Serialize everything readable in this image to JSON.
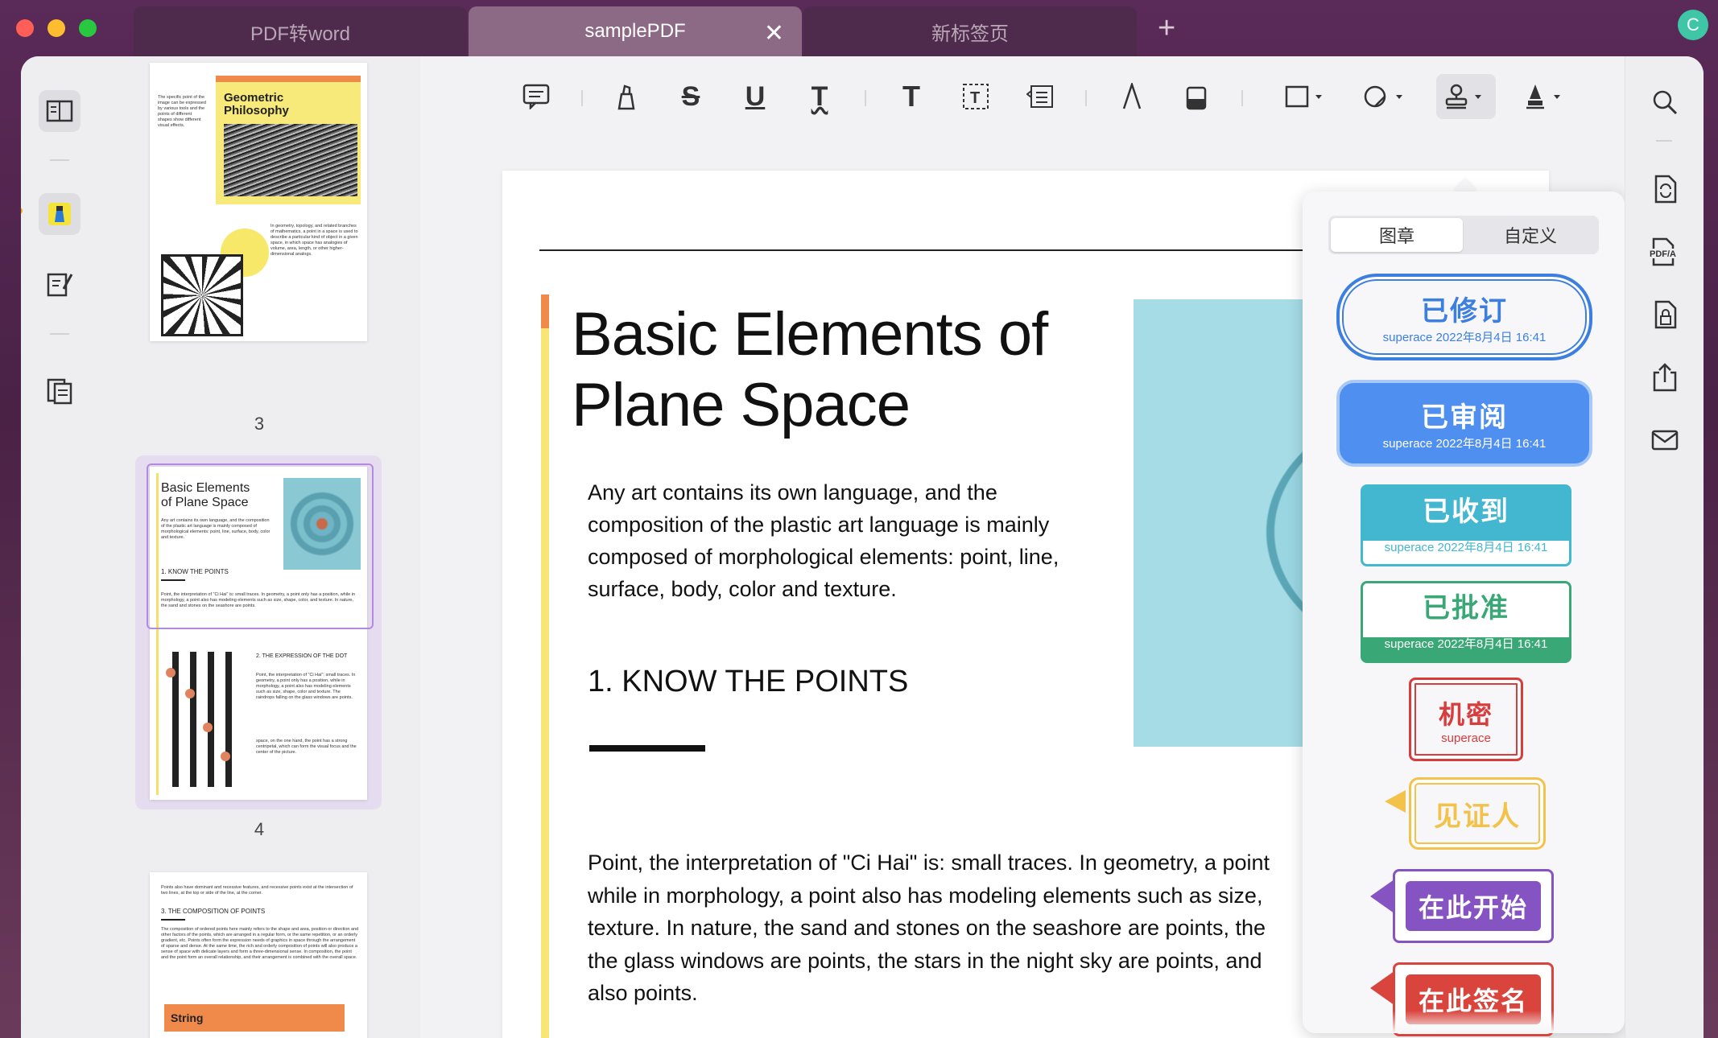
{
  "tabs": [
    {
      "label": "PDF转word"
    },
    {
      "label": "samplePDF"
    },
    {
      "label": "新标签页"
    }
  ],
  "tab_close": "✕",
  "tab_add": "+",
  "avatar_letter": "C",
  "thumbnails": {
    "page3": {
      "number": "3",
      "title": "Geometric Philosophy"
    },
    "page4": {
      "number": "4",
      "title": "Basic Elements of Plane Space",
      "section1": "1. KNOW THE POINTS",
      "section2": "2. THE EXPRESSION OF THE DOT"
    },
    "page5": {
      "section": "3. THE COMPOSITION OF POINTS",
      "box": "String"
    }
  },
  "document": {
    "title_line1": "Basic Elements of",
    "title_line2": "Plane Space",
    "intro": "Any art contains its own language, and the composition of the plastic art language is mainly composed of morphological elements: point, line, surface, body, color and texture.",
    "section_heading": "1. KNOW THE POINTS",
    "body_lines": [
      "Point, the interpretation of \"Ci Hai\" is: small traces. In geometry, a point",
      "while in morphology, a point also has modeling elements such as size,",
      "texture. In nature, the sand and stones on the seashore are points, the",
      "the glass windows are points, the stars in the night sky are points, and",
      "also points."
    ]
  },
  "stamp_panel": {
    "tabs": [
      "图章",
      "自定义"
    ],
    "stamps": [
      {
        "main": "已修订",
        "sub": "superace 2022年8月4日 16:41",
        "color": "#3d7fe0"
      },
      {
        "main": "已审阅",
        "sub": "superace 2022年8月4日 16:41",
        "color": "#4f8ff0"
      },
      {
        "main": "已收到",
        "sub": "superace 2022年8月4日 16:41",
        "color": "#43b6d0"
      },
      {
        "main": "已批准",
        "sub": "superace 2022年8月4日 16:41",
        "color": "#3aa776"
      },
      {
        "main": "机密",
        "sub": "superace",
        "color": "#d93c3c"
      },
      {
        "main": "见证人",
        "sub": "",
        "color": "#f2c24a"
      },
      {
        "main": "在此开始",
        "sub": "",
        "color": "#8654c2"
      },
      {
        "main": "在此签名",
        "sub": "",
        "color": "#d9443c"
      }
    ]
  }
}
